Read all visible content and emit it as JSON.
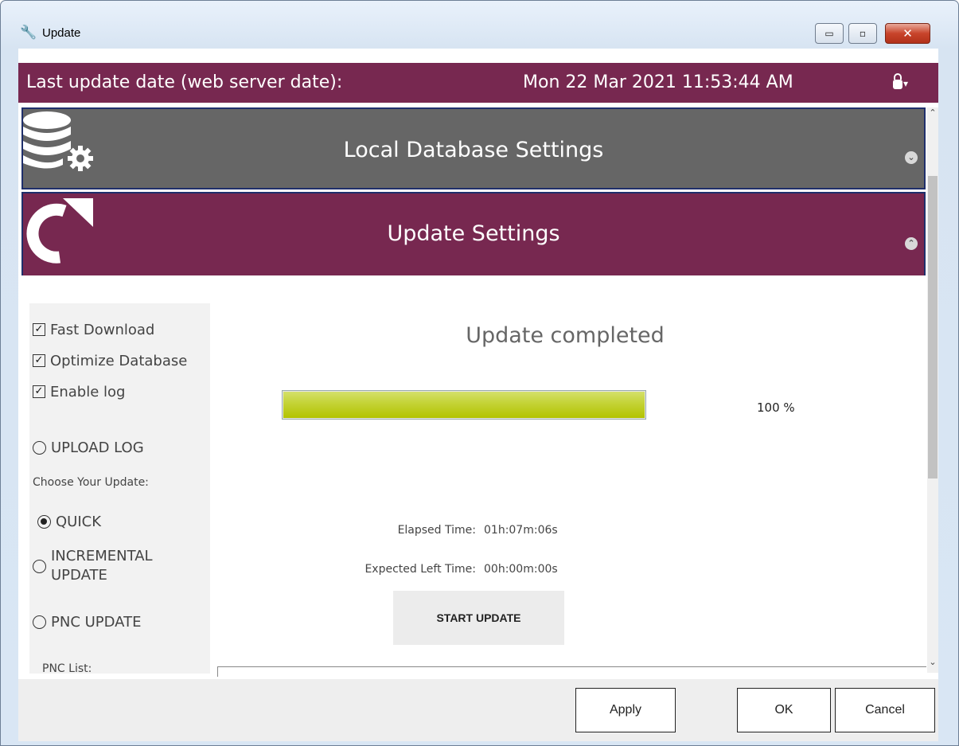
{
  "window": {
    "title": "Update",
    "controls": {
      "minimize": "▭",
      "maximize": "▫",
      "close": "✕"
    }
  },
  "info_bar": {
    "label": "Last update date (web server date):",
    "date": "Mon 22 Mar 2021 11:53:44 AM",
    "lock_icon": "padlock-icon"
  },
  "panels": {
    "database": {
      "title": "Local Database Settings",
      "icon": "database-gear-icon",
      "expanded": false
    },
    "update": {
      "title": "Update Settings",
      "icon": "refresh-arrow-icon",
      "expanded": true
    }
  },
  "options": {
    "checkboxes": [
      {
        "label": "Fast Download",
        "checked": true
      },
      {
        "label": "Optimize Database",
        "checked": true
      },
      {
        "label": "Enable log",
        "checked": true
      }
    ],
    "upload_log": "UPLOAD LOG",
    "choose_label": "Choose Your Update:",
    "update_types": [
      {
        "label": "QUICK",
        "selected": true
      },
      {
        "label": "INCREMENTAL UPDATE",
        "line1": "INCREMENTAL",
        "line2": "UPDATE",
        "selected": false
      },
      {
        "label": "PNC UPDATE",
        "selected": false
      }
    ],
    "pnc_list_label": "PNC List:"
  },
  "progress": {
    "status": "Update completed",
    "percent": 100,
    "percent_text": "100 %",
    "elapsed_label": "Elapsed Time:",
    "elapsed_value": "01h:07m:06s",
    "expected_label": "Expected Left Time:",
    "expected_value": "00h:00m:00s",
    "start_button": "START UPDATE"
  },
  "footer": {
    "apply": "Apply",
    "ok": "OK",
    "cancel": "Cancel"
  },
  "colors": {
    "accent": "#772850",
    "db_header": "#666666",
    "progress_fill": "#b3c300"
  }
}
